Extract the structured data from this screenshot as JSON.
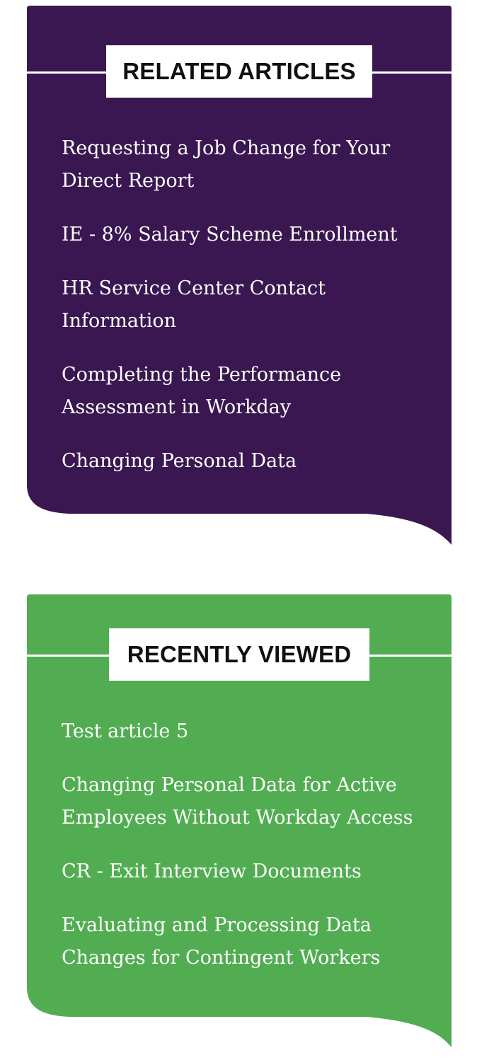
{
  "colors": {
    "related_bg": "#3a1750",
    "recent_bg": "#52ad52",
    "link_text": "#ffffff",
    "title_text": "#111111",
    "title_bg": "#ffffff"
  },
  "related": {
    "title": "RELATED ARTICLES",
    "items": [
      "Requesting a Job Change for Your Direct Report",
      "IE - 8% Salary Scheme Enrollment",
      "HR Service Center Contact Information",
      "Completing the Performance Assessment in Workday",
      "Changing Personal Data"
    ]
  },
  "recent": {
    "title": "RECENTLY VIEWED",
    "items": [
      "Test article 5",
      "Changing Personal Data for Active Employees Without Workday Access",
      "CR - Exit Interview Documents",
      "Evaluating and Processing Data Changes for Contingent Workers"
    ]
  }
}
